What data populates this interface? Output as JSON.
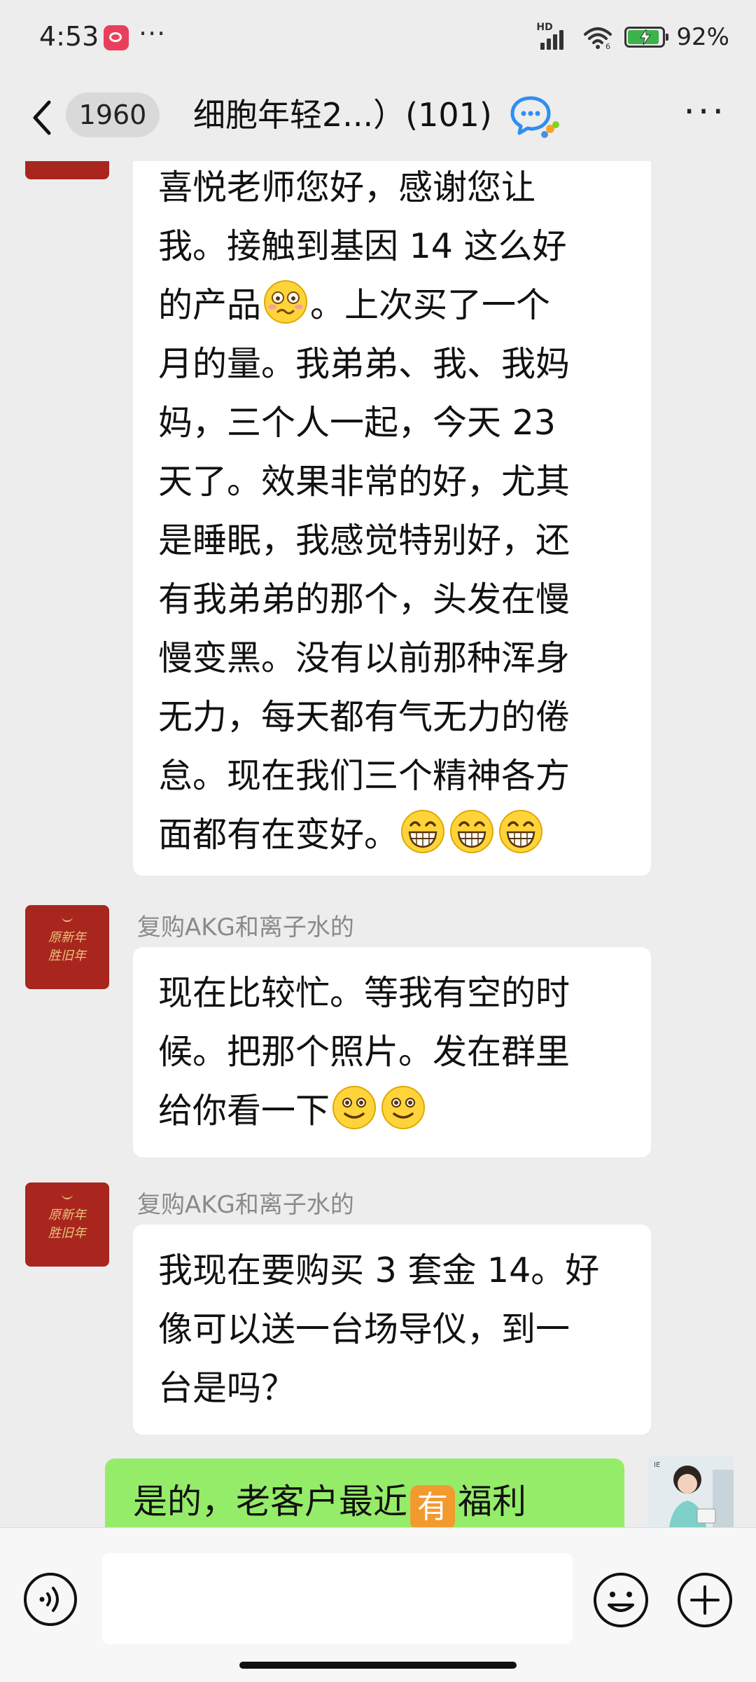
{
  "status_bar": {
    "time": "4:53",
    "more": "···",
    "network": "HD",
    "battery": "92%",
    "battery_level": 0.92
  },
  "header": {
    "unread_count": "1960",
    "title": "细胞年轻2...）(101)",
    "more": "···"
  },
  "messages": [
    {
      "lines": [
        "喜悦老师您好，感谢您让",
        "我。接触到基因 14 这么好",
        [
          "的产品",
          "[emoji:woozy]",
          "。上次买了一个"
        ],
        "月的量。我弟弟、我、我妈",
        "妈，三个人一起，今天 23",
        "天了。效果非常的好，尤其",
        "是睡眠，我感觉特别好，还",
        "有我弟弟的那个，头发在慢",
        "慢变黑。没有以前那种浑身",
        "无力，每天都有气无力的倦",
        "怠。现在我们三个精神各方",
        [
          "面都有在变好。",
          "[emoji:grin]",
          "[emoji:grin]",
          "[emoji:grin]"
        ]
      ]
    },
    {
      "sender": "复购AKG和离子水的",
      "avatar_text": "原新年 胜旧年",
      "lines": [
        "现在比较忙。等我有空的时",
        "候。把那个照片。发在群里",
        [
          "给你看一下",
          "[emoji:smile]",
          "[emoji:smile]"
        ]
      ]
    },
    {
      "sender": "复购AKG和离子水的",
      "avatar_text": "原新年 胜旧年",
      "lines": [
        "我现在要购买 3 套金 14。好",
        "像可以送一台场导仪，到一",
        "台是吗？"
      ]
    },
    {
      "self": true,
      "parts": [
        "是的，老客户最近",
        "有",
        "福利"
      ]
    }
  ],
  "input": {
    "placeholder": ""
  },
  "colors": {
    "background": "#ededed",
    "bubble_other": "#ffffff",
    "bubble_self": "#95ec69",
    "shop_avatar": "#a8261e",
    "badge": "#f39a2f"
  },
  "icons": [
    "back-icon",
    "group-chat-icon",
    "more-icon",
    "voice-icon",
    "emoji-icon",
    "plus-icon"
  ]
}
